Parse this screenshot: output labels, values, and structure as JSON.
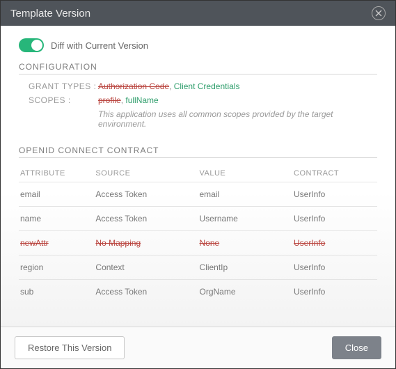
{
  "header": {
    "title": "Template Version"
  },
  "toggle": {
    "label": "Diff with Current Version"
  },
  "sections": {
    "config_heading": "CONFIGURATION",
    "contract_heading": "OPENID CONNECT CONTRACT"
  },
  "config": {
    "grant_types_label": "GRANT TYPES :",
    "grant_types_removed": "Authorization Code",
    "grant_types_sep": ", ",
    "grant_types_added": "Client Credentials",
    "scopes_label": "SCOPES :",
    "scopes_removed": "profile",
    "scopes_sep": ", ",
    "scopes_added": "fullName",
    "scopes_note": "This application uses all common scopes provided by the target environment."
  },
  "contract": {
    "columns": {
      "attribute": "ATTRIBUTE",
      "source": "SOURCE",
      "value": "VALUE",
      "contract": "CONTRACT"
    },
    "rows": [
      {
        "attribute": "email",
        "source": "Access Token",
        "value": "email",
        "contract": "UserInfo",
        "removed": false
      },
      {
        "attribute": "name",
        "source": "Access Token",
        "value": "Username",
        "contract": "UserInfo",
        "removed": false
      },
      {
        "attribute": "newAttr",
        "source": "No Mapping",
        "value": "None",
        "contract": "UserInfo",
        "removed": true
      },
      {
        "attribute": "region",
        "source": "Context",
        "value": "ClientIp",
        "contract": "UserInfo",
        "removed": false
      },
      {
        "attribute": "sub",
        "source": "Access Token",
        "value": "OrgName",
        "contract": "UserInfo",
        "removed": false
      }
    ]
  },
  "footer": {
    "restore_label": "Restore This Version",
    "close_label": "Close"
  }
}
